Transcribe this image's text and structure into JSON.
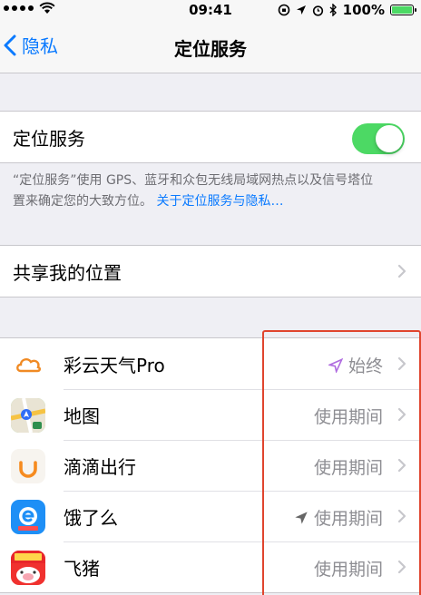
{
  "status_bar": {
    "time": "09:41",
    "battery": "100%"
  },
  "nav": {
    "back_label": "隐私",
    "title": "定位服务"
  },
  "location_services": {
    "label": "定位服务",
    "enabled": true,
    "note_text": "“定位服务”使用 GPS、蓝牙和众包无线局域网热点以及信号塔位置来确定您的大致方位。",
    "note_link": "关于定位服务与隐私…"
  },
  "share_location": {
    "label": "共享我的位置"
  },
  "apps": [
    {
      "name": "彩云天气Pro",
      "value": "始终",
      "arrow": "purple",
      "icon": "cloud-icon"
    },
    {
      "name": "地图",
      "value": "使用期间",
      "arrow": "none",
      "icon": "maps-icon"
    },
    {
      "name": "滴滴出行",
      "value": "使用期间",
      "arrow": "none",
      "icon": "didi-icon"
    },
    {
      "name": "饿了么",
      "value": "使用期间",
      "arrow": "gray",
      "icon": "eleme-icon"
    },
    {
      "name": "飞猪",
      "value": "使用期间",
      "arrow": "none",
      "icon": "fliggy-icon"
    }
  ],
  "colors": {
    "ios_blue": "#0a7aff",
    "toggle_green": "#4cd964",
    "highlight_red": "#e0452e"
  }
}
